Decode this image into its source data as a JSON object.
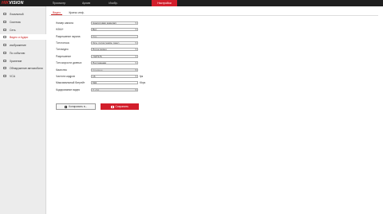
{
  "logo": {
    "brand_red": "HIK",
    "brand_white": "VISION"
  },
  "topnav": {
    "items": [
      "Просмотр",
      "Архив",
      "Изобр.",
      "Настройки"
    ],
    "active_index": 3
  },
  "colors": {
    "accent": "#d21e2b",
    "topbar": "#1f1f1f",
    "sidebar": "#ececec"
  },
  "sidebar": {
    "active_index": 3,
    "items": [
      {
        "label": "Локальный",
        "icon": "monitor-icon"
      },
      {
        "label": "Система",
        "icon": "system-icon"
      },
      {
        "label": "Сеть",
        "icon": "network-icon"
      },
      {
        "label": "Видео и Аудио",
        "icon": "video-icon"
      },
      {
        "label": "изображение",
        "icon": "image-icon"
      },
      {
        "label": "По событию",
        "icon": "event-icon"
      },
      {
        "label": "Хранение",
        "icon": "storage-icon"
      },
      {
        "label": "Обнаружение автомобиля",
        "icon": "car-icon"
      },
      {
        "label": "VCA",
        "icon": "vca-icon"
      }
    ]
  },
  "tabs": {
    "items": [
      "Видео",
      "Кратко инф."
    ],
    "active_index": 0
  },
  "form": {
    "channel_label": "Номер канала",
    "channel_value": "Аналоговая камера1",
    "h264_label": "H264+",
    "h264_value": "Вкл",
    "resolution_label": "Разрешение экрана",
    "resolution_value": "PAL",
    "stream_label": "Тип потока",
    "stream_value": "Осн. поток (норм. реж.)",
    "video_type_label": "Тип видео",
    "video_type_value": "Поток видео",
    "res2_label": "Разрешение",
    "res2_value": "704*576",
    "bitrate_type_label": "Тип скорости данных",
    "bitrate_type_value": "Постоянная",
    "quality_label": "Качество",
    "quality_value": "Среднее",
    "fps_label": "Частота кадров",
    "fps_value": "16",
    "fps_unit": "fps",
    "max_bitrate_label": "Максимальный битрейт",
    "max_bitrate_value": "592",
    "max_bitrate_unit": "Kbps",
    "codec_label": "Кодирование видео",
    "codec_value": "H.264"
  },
  "buttons": {
    "copy": "Копировать в...",
    "save": "Сохранить"
  }
}
